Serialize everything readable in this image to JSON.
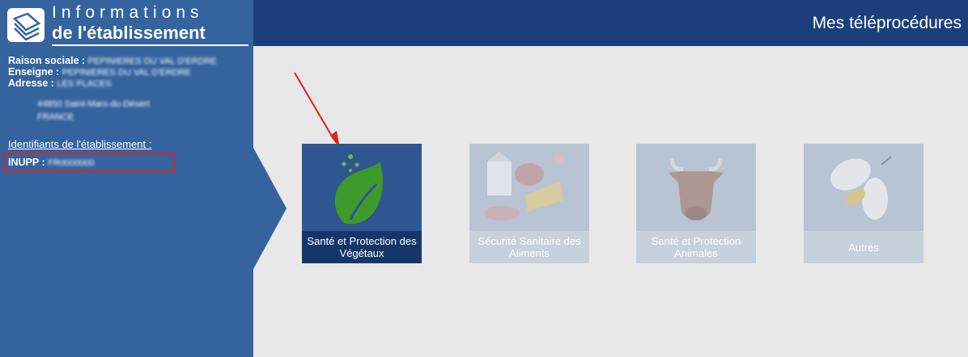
{
  "sidebar": {
    "title_line1": "Informations",
    "title_line2": "de l'établissement",
    "raison_label": "Raison sociale :",
    "raison_value": "PEPINIERES DU VAL D'ERDRE",
    "enseigne_label": "Enseigne :",
    "enseigne_value": "PEPINIERES DU VAL D'ERDRE",
    "adresse_label": "Adresse :",
    "adresse_line1": "LES PLACES",
    "adresse_line2": "44850 Saint-Mars-du-Désert",
    "adresse_line3": "FRANCE",
    "identifiants_title": "Identifiants de l'établissement :",
    "inupp_label": "INUPP :",
    "inupp_value": "FR0000000"
  },
  "header": {
    "title": "Mes téléprocédures"
  },
  "tiles": [
    {
      "label": "Santé et Protection des Végétaux",
      "state": "active"
    },
    {
      "label": "Sécurité Sanitaire des Aliments",
      "state": "disabled"
    },
    {
      "label": "Santé et Protection Animales",
      "state": "disabled"
    },
    {
      "label": "Autres",
      "state": "disabled"
    }
  ],
  "colors": {
    "sidebar_bg": "#35639e",
    "header_bg": "#1b3f7a",
    "active_tile": "#2f5691",
    "highlight_red": "#d9232a"
  }
}
